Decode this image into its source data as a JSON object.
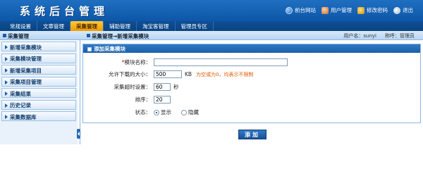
{
  "header": {
    "title": "系统后台管理",
    "links": [
      {
        "label": "前台网站",
        "icon": "home-icon"
      },
      {
        "label": "用户管理",
        "icon": "user-icon"
      },
      {
        "label": "修改密码",
        "icon": "key-icon"
      },
      {
        "label": "退出",
        "icon": "exit-icon"
      }
    ]
  },
  "nav": {
    "tabs": [
      "常规设置",
      "文章管理",
      "采集管理",
      "辅助管理",
      "淘宝客管理",
      "管理员专区"
    ],
    "active": "采集管理"
  },
  "subbar": {
    "section": "采集管理",
    "breadcrumb": "采集管理→新增采集模块",
    "user_label": "用户名：",
    "user_value": "sunyi",
    "role_label": "称呼：",
    "role_value": "管理员"
  },
  "sidebar": {
    "items": [
      "新增采集模块",
      "采集模块管理",
      "新增采集项目",
      "采集项目管理",
      "采集结果",
      "历史记录",
      "采集数据库"
    ]
  },
  "form": {
    "title": "添加采集模块",
    "name_label": "模块名称：",
    "name_value": "",
    "size_label": "允许下载的大小：",
    "size_value": "500",
    "size_unit": "KB",
    "size_hint": "为空或为0，均表示不限制",
    "timeout_label": "采集超时设置：",
    "timeout_value": "60",
    "timeout_unit": "秒",
    "order_label": "排序：",
    "order_value": "20",
    "status_label": "状态：",
    "status_options": [
      "显示",
      "隐藏"
    ],
    "status_selected": "显示",
    "submit_label": "添加"
  },
  "colors": {
    "header_blue": "#1f6fc0",
    "active_tab": "#f29a00",
    "hint_orange": "#e05a00"
  }
}
